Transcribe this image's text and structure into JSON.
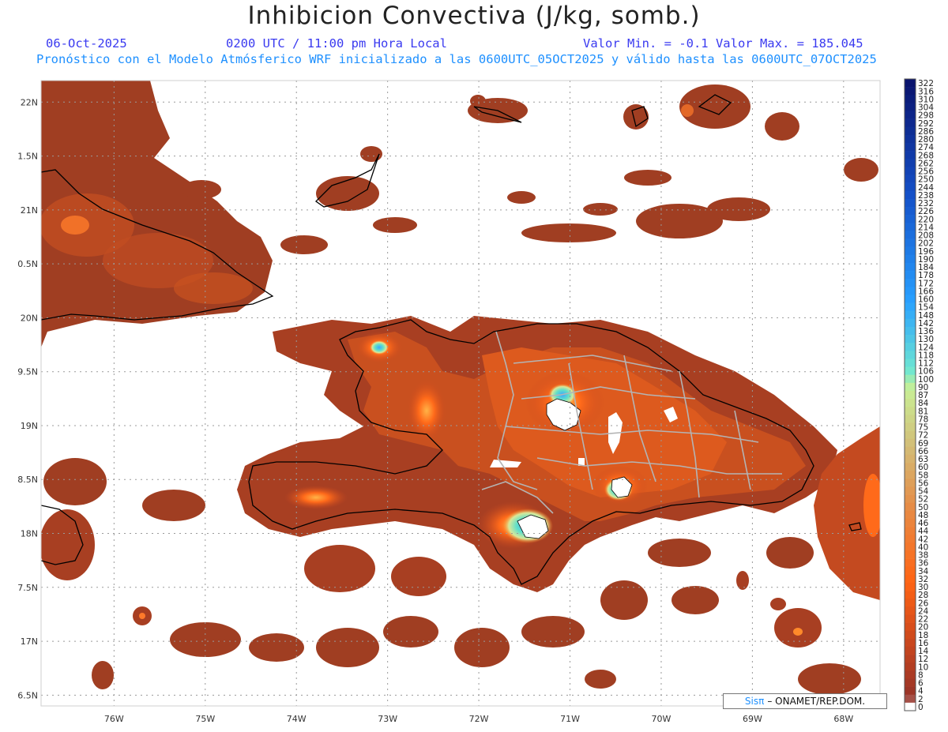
{
  "header": {
    "title": "Inhibicion Convectiva (J/kg, somb.)",
    "date": "06-Oct-2025",
    "time": "0200 UTC / 11:00 pm Hora Local",
    "minmax": "Valor Min. = -0.1  Valor Max. = 185.045",
    "forecast": "Pronóstico con el Modelo Atmósferico WRF inicializado a las 0600UTC_05OCT2025 y válido hasta las  0600UTC_07OCT2025"
  },
  "map": {
    "lon_range": [
      -76.8,
      -67.6
    ],
    "lat_range": [
      16.4,
      22.2
    ],
    "lon_ticks": [
      -76,
      -75,
      -74,
      -73,
      -72,
      -71,
      -70,
      -69,
      -68
    ],
    "lon_labels": [
      "76W",
      "75W",
      "74W",
      "73W",
      "72W",
      "71W",
      "70W",
      "69W",
      "68W"
    ],
    "lat_ticks": [
      22,
      21.5,
      21,
      20.5,
      20,
      19.5,
      19,
      18.5,
      18,
      17.5,
      17,
      16.5
    ],
    "lat_labels": [
      "22N",
      "1.5N",
      "21N",
      "0.5N",
      "20N",
      "9.5N",
      "19N",
      "8.5N",
      "18N",
      "7.5N",
      "17N",
      "6.5N"
    ],
    "fill_color_base": "#9a3a22",
    "fill_color_warm": "#d4551f",
    "fill_color_hot": "#ff6a1a",
    "highlight_color": "#62e0c8",
    "highlight_blue": "#33a0ff",
    "coast_color": "#000000",
    "border_color": "#b0b0b0"
  },
  "colorbar": {
    "labels": [
      "322",
      "316",
      "310",
      "304",
      "298",
      "292",
      "286",
      "280",
      "274",
      "268",
      "262",
      "256",
      "250",
      "244",
      "238",
      "232",
      "226",
      "220",
      "214",
      "208",
      "202",
      "196",
      "190",
      "184",
      "178",
      "172",
      "166",
      "160",
      "154",
      "148",
      "142",
      "136",
      "130",
      "124",
      "118",
      "112",
      "106",
      "100",
      "90",
      "87",
      "84",
      "81",
      "78",
      "75",
      "72",
      "69",
      "66",
      "63",
      "60",
      "58",
      "56",
      "54",
      "52",
      "50",
      "48",
      "46",
      "44",
      "42",
      "40",
      "38",
      "36",
      "34",
      "32",
      "30",
      "28",
      "26",
      "24",
      "22",
      "20",
      "18",
      "16",
      "14",
      "12",
      "10",
      "8",
      "6",
      "4",
      "2",
      "0"
    ]
  },
  "brand": {
    "sis": "Sisπ",
    "org": "– ONAMET/REP.DOM."
  }
}
